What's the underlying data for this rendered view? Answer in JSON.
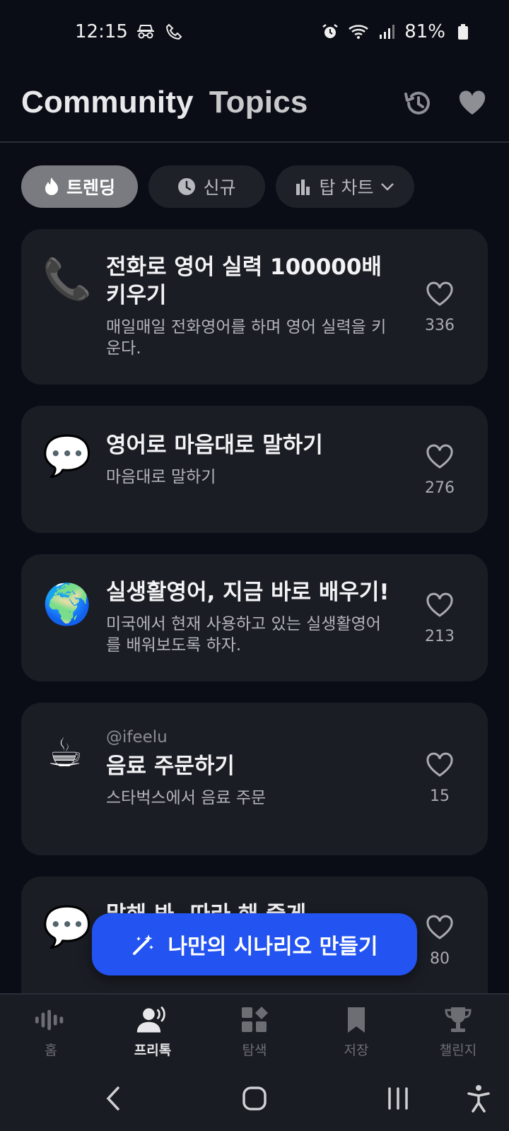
{
  "status": {
    "time": "12:15",
    "battery": "81%"
  },
  "header": {
    "title_word1": "Community",
    "title_word2": "Topics"
  },
  "filters": {
    "trending": "트렌딩",
    "new": "신규",
    "top_chart": "탑 차트"
  },
  "topics": [
    {
      "emoji": "📞",
      "handle": "",
      "title": "전화로 영어 실력 100000배 키우기",
      "desc": "매일매일 전화영어를 하며 영어 실력을 키운다.",
      "likes": "336"
    },
    {
      "emoji": "💬",
      "handle": "",
      "title": "영어로 마음대로 말하기",
      "desc": "마음대로 말하기",
      "likes": "276"
    },
    {
      "emoji": "🌍",
      "handle": "",
      "title": "실생활영어, 지금 바로 배우기!",
      "desc": "미국에서 현재 사용하고 있는 실생활영어를 배워보도록 하자.",
      "likes": "213"
    },
    {
      "emoji": "☕",
      "handle": "@ifeelu",
      "title": "음료 주문하기",
      "desc": "스타벅스에서 음료 주문",
      "likes": "15"
    },
    {
      "emoji": "💬",
      "handle": "",
      "title": "말해 봐, 따라 해 줄게",
      "desc": "",
      "likes": "80"
    }
  ],
  "fab": {
    "label": "나만의 시나리오 만들기"
  },
  "bottom_nav": [
    {
      "label": "홈",
      "icon": "waveform-icon"
    },
    {
      "label": "프리톡",
      "icon": "speaking-person-icon"
    },
    {
      "label": "탐색",
      "icon": "grid-icon"
    },
    {
      "label": "저장",
      "icon": "bookmark-icon"
    },
    {
      "label": "챌린지",
      "icon": "trophy-icon"
    }
  ],
  "colors": {
    "accent": "#2353f0",
    "background": "#0a0d16",
    "card": "#1b1d25"
  }
}
